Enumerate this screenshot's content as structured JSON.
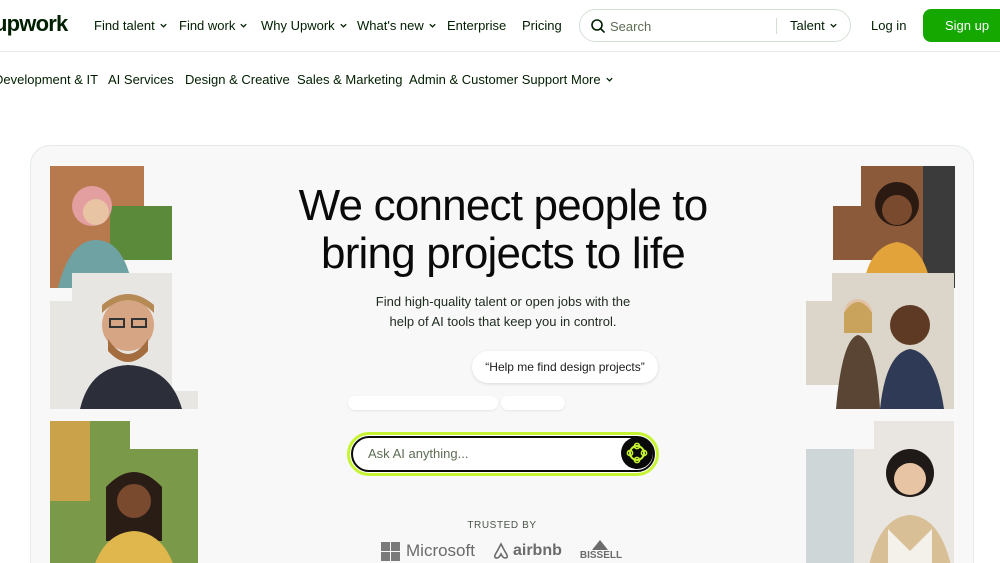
{
  "brand": {
    "logo": "upwork"
  },
  "nav": {
    "find_talent": "Find talent",
    "find_work": "Find work",
    "why_upwork": "Why Upwork",
    "whats_new": "What's new",
    "enterprise": "Enterprise",
    "pricing": "Pricing"
  },
  "search": {
    "placeholder": "Search",
    "scope": "Talent"
  },
  "auth": {
    "login": "Log in",
    "signup": "Sign up"
  },
  "categories": [
    "Development & IT",
    "AI Services",
    "Design & Creative",
    "Sales & Marketing",
    "Admin & Customer Support",
    "More"
  ],
  "hero": {
    "headline_line1": "We connect people to",
    "headline_line2": "bring projects to life",
    "subtitle_line1": "Find high-quality talent or open jobs with the",
    "subtitle_line2": "help of AI tools that keep you in control.",
    "suggestion_chip": "“Help me find design projects”",
    "ask_placeholder": "Ask AI anything...",
    "trusted_by": "TRUSTED BY"
  },
  "trusted_logos": [
    "Microsoft",
    "airbnb",
    "BISSELL"
  ],
  "colors": {
    "brand_green": "#14a800",
    "ai_accent": "#c6f432",
    "text": "#001e00",
    "hero_bg": "#f7f8f7"
  },
  "icons": {
    "search": "search-icon",
    "chevron": "chevron-down-icon",
    "ai": "ai-sparkle-icon"
  }
}
